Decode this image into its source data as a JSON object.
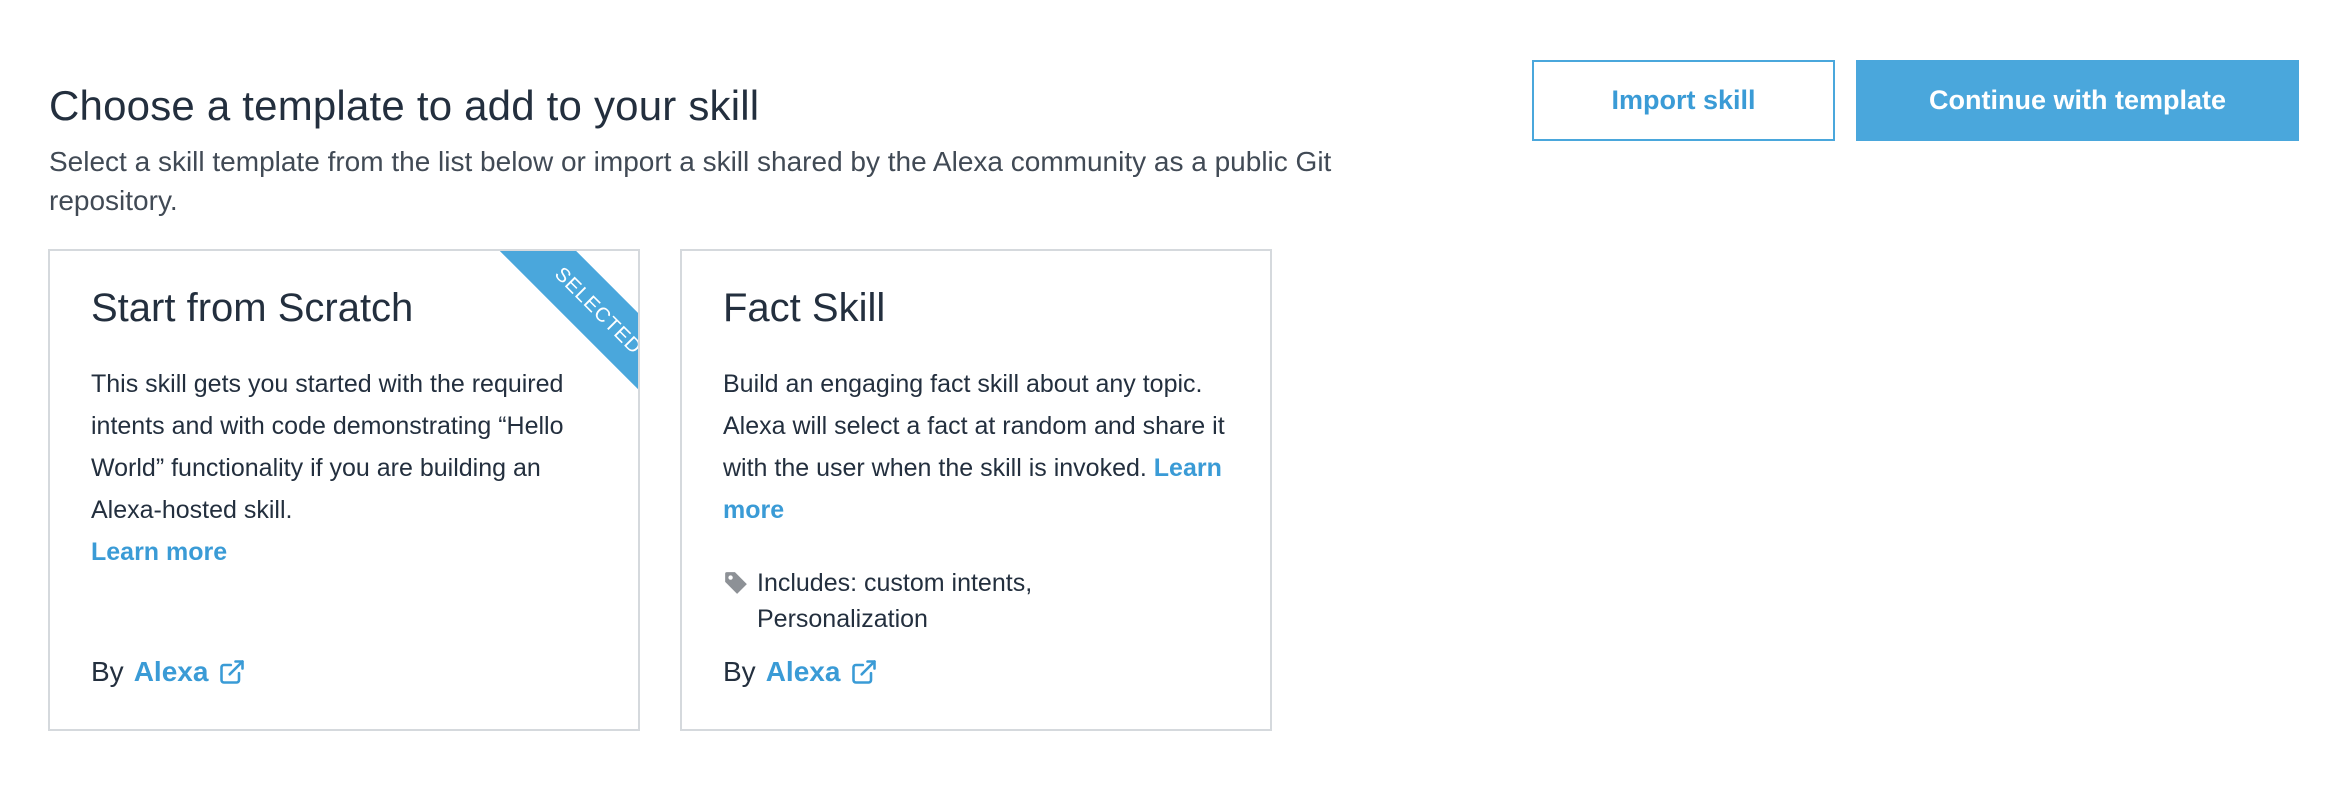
{
  "header": {
    "title": "Choose a template to add to your skill",
    "subtitle": "Select a skill template from the list below or import a skill shared by the Alexa community as a public Git repository."
  },
  "actions": {
    "import_label": "Import skill",
    "continue_label": "Continue with template"
  },
  "colors": {
    "accent": "#4aa7dc",
    "link": "#3a9bd6",
    "text": "#232f3e",
    "card_border": "#d5d9dd"
  },
  "templates": [
    {
      "title": "Start from Scratch",
      "description": "This skill gets you started with the required intents and with code demonstrating “Hello World” functionality if you are building an Alexa-hosted skill.",
      "learn_more": "Learn more",
      "badge": "SELECTED",
      "selected": true,
      "by_label": "By",
      "author": "Alexa",
      "author_icon": "external-link-icon"
    },
    {
      "title": "Fact Skill",
      "description": "Build an engaging fact skill about any topic. Alexa will select a fact at random and share it with the user when the skill is invoked.",
      "learn_more": "Learn more",
      "selected": false,
      "includes": "Includes: custom intents, Personalization",
      "includes_icon": "tag-icon",
      "by_label": "By",
      "author": "Alexa",
      "author_icon": "external-link-icon"
    }
  ]
}
